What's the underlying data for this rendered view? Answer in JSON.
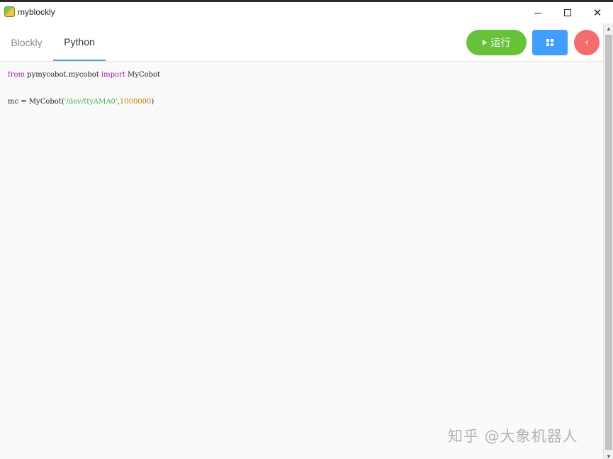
{
  "window": {
    "title": "myblockly",
    "controls": {
      "minimize": "—",
      "maximize": "☐",
      "close": "✕"
    }
  },
  "tabs": [
    {
      "label": "Blockly",
      "active": false
    },
    {
      "label": "Python",
      "active": true
    }
  ],
  "toolbar": {
    "run_label": "运行",
    "colors": {
      "run": "#67c23a",
      "grid": "#409eff",
      "back": "#f56c6c",
      "tab_underline": "#409eff"
    }
  },
  "code": {
    "line1": {
      "kw1": "from",
      "module": " pymycobot.mycobot ",
      "kw2": "import",
      "name": " MyCobot"
    },
    "line2": {
      "prefix": "mc = MyCobot(",
      "string": "'/dev/ttyAMA0'",
      "sep": ",",
      "number": "1000000",
      "suffix": ")"
    },
    "colors": {
      "keyword": "#a020b0",
      "string": "#4caf50",
      "number": "#c08000"
    }
  },
  "watermark": "知乎 @大象机器人"
}
